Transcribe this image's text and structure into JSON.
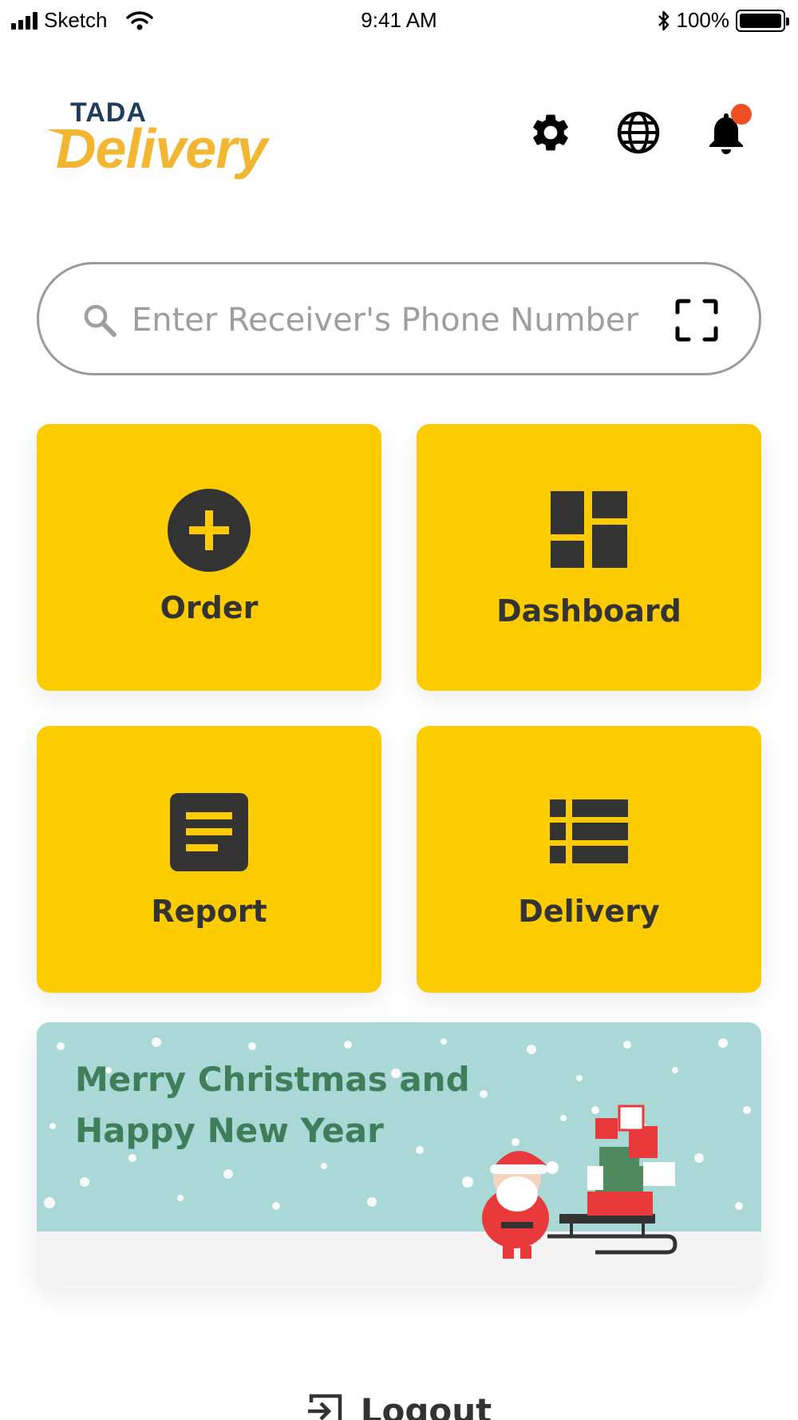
{
  "status_bar": {
    "carrier": "Sketch",
    "time": "9:41 AM",
    "battery": "100%"
  },
  "header": {
    "logo_top": "TADA",
    "logo_main": "Delivery",
    "icons": [
      "gear-icon",
      "globe-icon",
      "bell-icon"
    ],
    "notification_dot_color": "#f04e23"
  },
  "search": {
    "placeholder": "Enter Receiver's Phone Number",
    "value": ""
  },
  "tiles": [
    {
      "label": "Order",
      "icon": "plus-circle-icon"
    },
    {
      "label": "Dashboard",
      "icon": "dashboard-icon"
    },
    {
      "label": "Report",
      "icon": "report-icon"
    },
    {
      "label": "Delivery",
      "icon": "list-icon"
    }
  ],
  "banner": {
    "text": "Merry Christmas and\nHappy New Year"
  },
  "logout": {
    "label": "Logout",
    "icon": "logout-icon"
  },
  "colors": {
    "accent": "#fccc00",
    "logo_orange": "#f2b632",
    "logo_navy": "#1f3d5b",
    "icon_dark": "#333333",
    "banner_bg": "#a9d8d6",
    "banner_text": "#3f7e5a"
  }
}
